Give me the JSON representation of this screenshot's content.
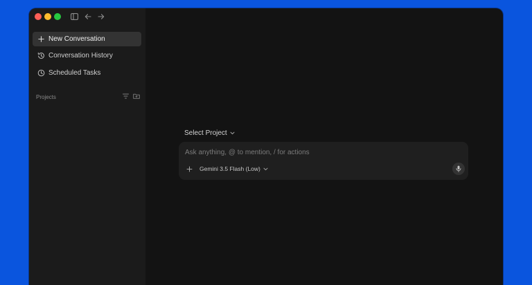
{
  "colors": {
    "desktop": "#0a55de",
    "window_bg": "#131313",
    "sidebar_bg": "#1b1b1b",
    "traffic_close": "#ff5f57",
    "traffic_minimize": "#febc2e",
    "traffic_zoom": "#28c840"
  },
  "titlebar": {
    "icons": [
      "sidebar-toggle-icon",
      "arrow-left-icon",
      "arrow-right-icon"
    ]
  },
  "sidebar": {
    "items": [
      {
        "label": "New Conversation",
        "icon": "plus-icon",
        "active": true
      },
      {
        "label": "Conversation History",
        "icon": "history-icon",
        "active": false
      },
      {
        "label": "Scheduled Tasks",
        "icon": "clock-icon",
        "active": false
      }
    ],
    "projects": {
      "label": "Projects",
      "tools": [
        "filter-icon",
        "new-folder-icon"
      ]
    }
  },
  "main": {
    "project_selector": {
      "label": "Select Project",
      "icon": "chevron-down-icon"
    },
    "composer": {
      "placeholder": "Ask anything, @ to mention, / for actions",
      "value": "",
      "model": "Gemini 3.5 Flash (Low)",
      "icons": [
        "plus-icon",
        "chevron-down-icon",
        "microphone-icon"
      ]
    }
  }
}
